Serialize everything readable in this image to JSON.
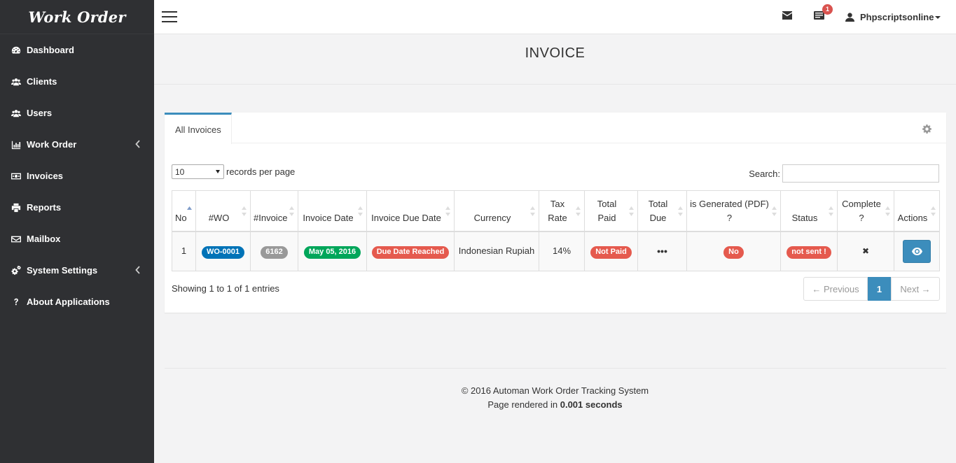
{
  "app": {
    "brand": "Work Order"
  },
  "sidebar": {
    "items": [
      {
        "label": "Dashboard",
        "icon": "dashboard-icon"
      },
      {
        "label": "Clients",
        "icon": "users-icon"
      },
      {
        "label": "Users",
        "icon": "users-icon"
      },
      {
        "label": "Work Order",
        "icon": "bar-chart-icon",
        "expandable": true
      },
      {
        "label": "Invoices",
        "icon": "money-icon"
      },
      {
        "label": "Reports",
        "icon": "print-icon"
      },
      {
        "label": "Mailbox",
        "icon": "envelope-icon"
      },
      {
        "label": "System Settings",
        "icon": "cogs-icon",
        "expandable": true
      },
      {
        "label": "About Applications",
        "icon": "question-icon"
      }
    ]
  },
  "topbar": {
    "notification_count": "1",
    "username": "Phpscriptsonline"
  },
  "page": {
    "title": "INVOICE"
  },
  "panel": {
    "tab_label": "All Invoices",
    "page_size": "10",
    "records_label": "records per page",
    "search_label": "Search:",
    "search_value": "",
    "showing": "Showing 1 to 1 of 1 entries",
    "prev_label": "← Previous",
    "next_label": "Next →",
    "current_page": "1"
  },
  "table": {
    "columns": [
      "No",
      "#WO",
      "#Invoice",
      "Invoice Date",
      "Invoice Due Date",
      "Currency",
      "Tax Rate",
      "Total Paid",
      "Total Due",
      "is Generated (PDF) ?",
      "Status",
      "Complete ?",
      "Actions"
    ],
    "rows": [
      {
        "no": "1",
        "wo": "WO-0001",
        "invoice": "6162",
        "invoice_date": "May 05, 2016",
        "due_date": "Due Date Reached",
        "currency": "Indonesian Rupiah",
        "tax_rate": "14%",
        "total_paid": "Not Paid",
        "total_due": "•••",
        "generated": "No",
        "status": "not sent !",
        "complete": "✖"
      }
    ]
  },
  "footer": {
    "copyright": "© 2016 Automan Work Order Tracking System",
    "rendered_prefix": "Page rendered in",
    "rendered_time": "0.001 seconds"
  },
  "colors": {
    "sidebar_bg": "#2f3033",
    "primary": "#3c8dbc",
    "danger": "#e55a4e",
    "success": "#00a65a"
  }
}
